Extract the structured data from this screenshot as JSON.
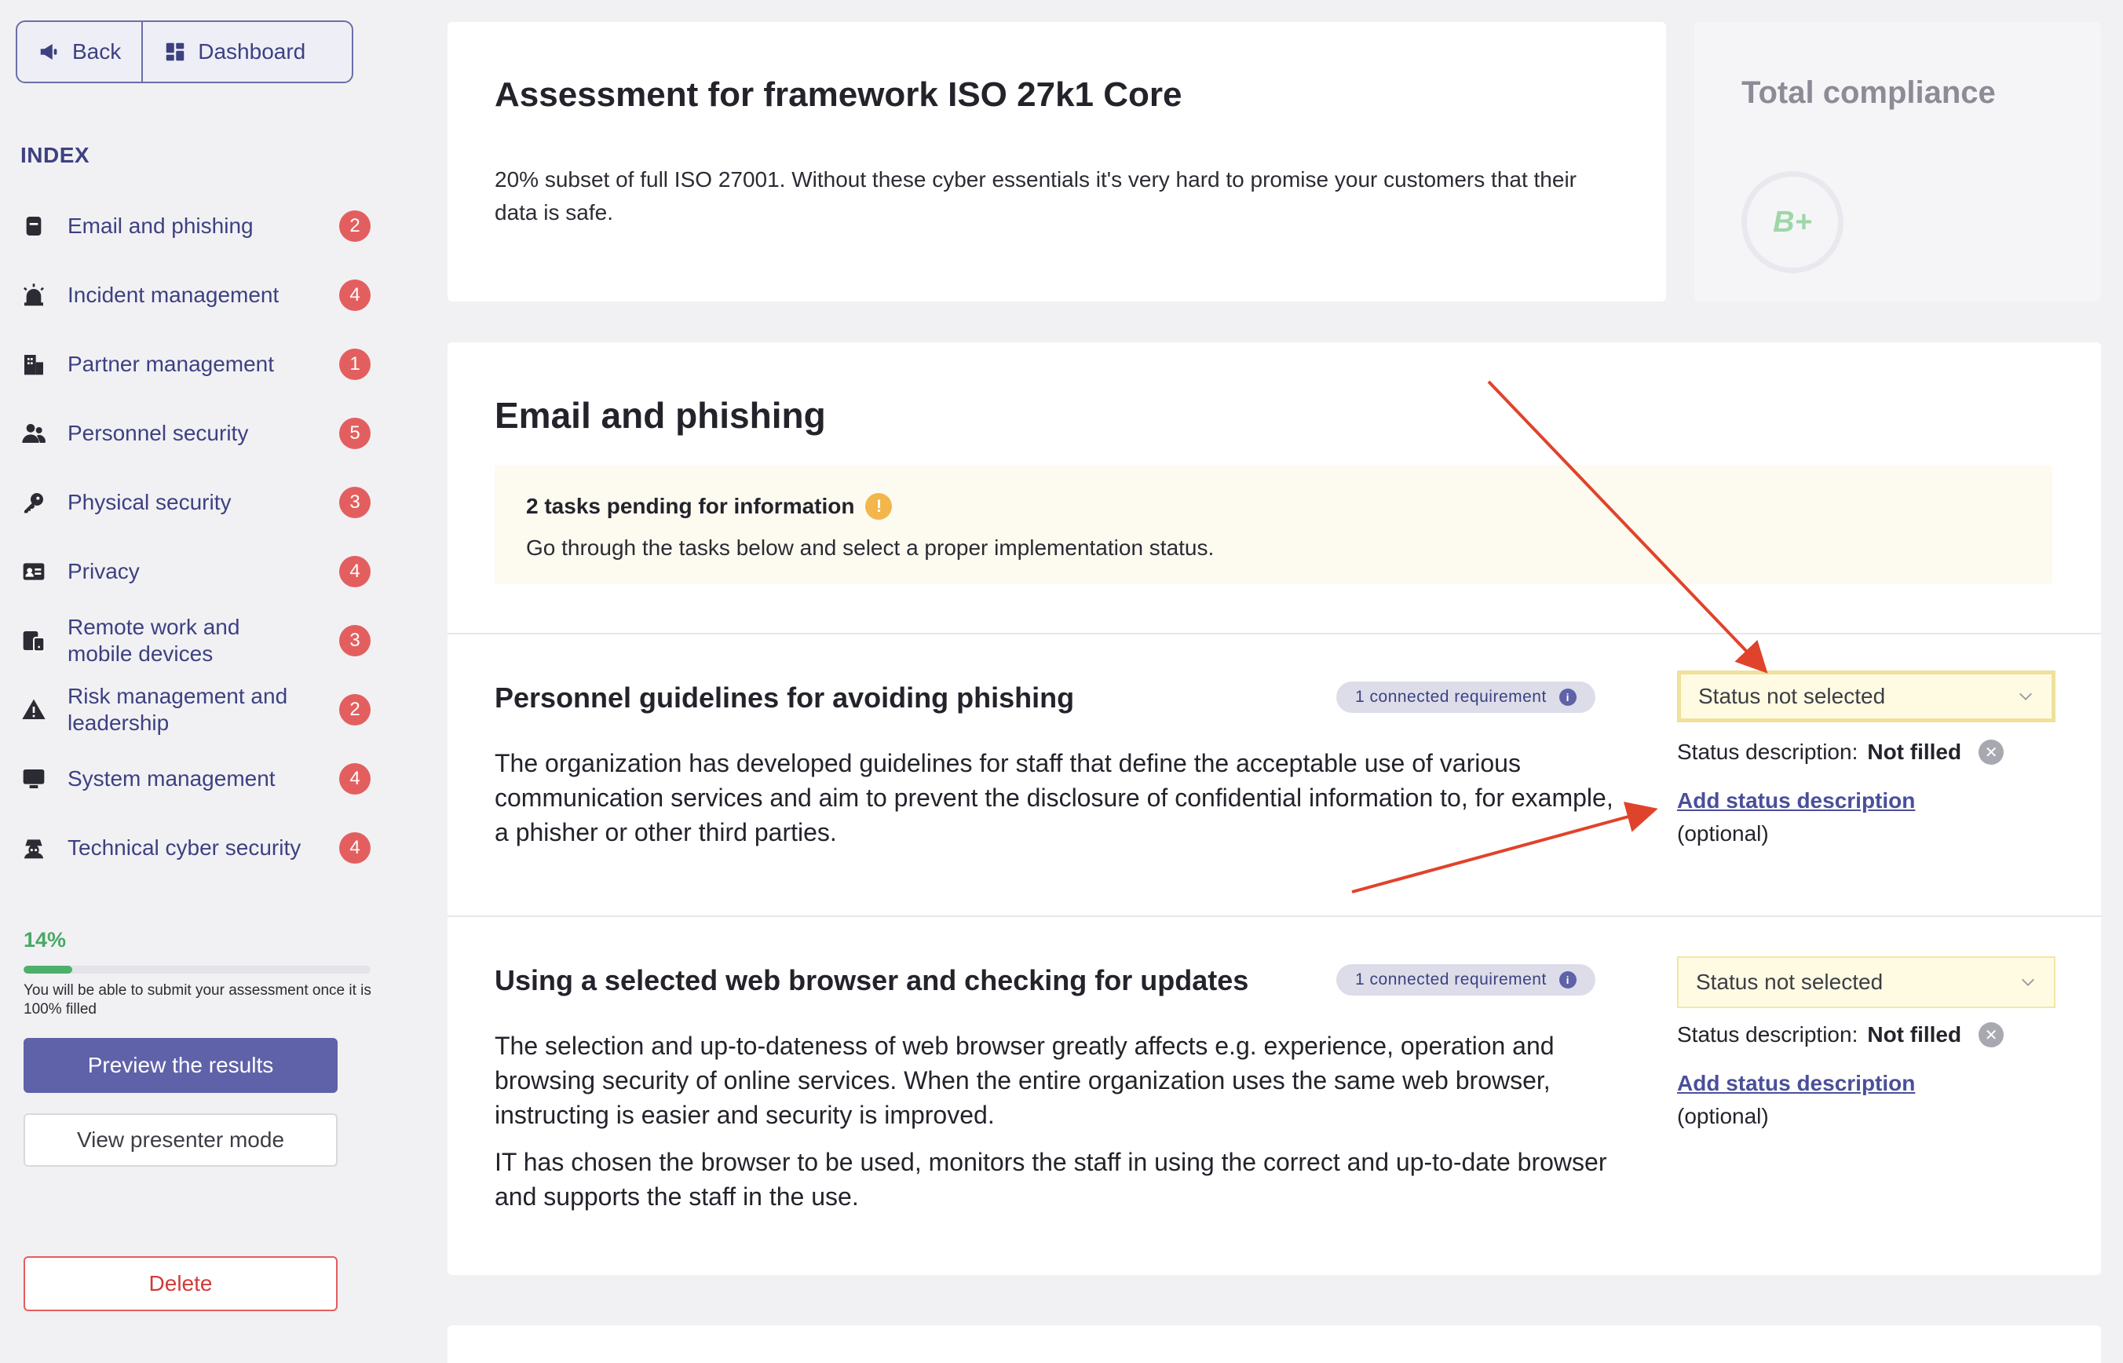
{
  "nav": {
    "back_label": "Back",
    "dashboard_label": "Dashboard"
  },
  "sidebar": {
    "index_title": "INDEX",
    "items": [
      {
        "label": "Email and phishing",
        "count": "2",
        "icon": "email-icon"
      },
      {
        "label": "Incident management",
        "count": "4",
        "icon": "alarm-icon"
      },
      {
        "label": "Partner management",
        "count": "1",
        "icon": "building-icon"
      },
      {
        "label": "Personnel security",
        "count": "5",
        "icon": "users-icon"
      },
      {
        "label": "Physical security",
        "count": "3",
        "icon": "key-icon"
      },
      {
        "label": "Privacy",
        "count": "4",
        "icon": "id-card-icon"
      },
      {
        "label": "Remote work and mobile devices",
        "count": "3",
        "icon": "devices-icon"
      },
      {
        "label": "Risk management and leadership",
        "count": "2",
        "icon": "warning-icon"
      },
      {
        "label": "System management",
        "count": "4",
        "icon": "monitor-icon"
      },
      {
        "label": "Technical cyber security",
        "count": "4",
        "icon": "user-secret-icon"
      }
    ],
    "progress_percent": 14,
    "progress_label": "14%",
    "progress_hint": "You will be able to submit your assessment once it is 100% filled",
    "preview_label": "Preview the results",
    "presenter_label": "View presenter mode",
    "delete_label": "Delete"
  },
  "hero": {
    "title": "Assessment for framework ISO 27k1 Core",
    "description": "20% subset of full ISO 27001. Without these cyber essentials it's very hard to promise your customers that their data is safe."
  },
  "compliance": {
    "title": "Total compliance",
    "grade": "B+"
  },
  "section": {
    "title": "Email and phishing",
    "notice_title": "2 tasks pending for information",
    "notice_icon": "!",
    "notice_text": "Go through the tasks below and select a proper implementation status.",
    "tasks": [
      {
        "title": "Personnel guidelines for avoiding phishing",
        "requirement": "1 connected requirement",
        "description": "The organization has developed guidelines for staff that define the acceptable use of various communication services and aim to prevent the disclosure of confidential information to, for example, a phisher or other third parties.",
        "status": "Status not selected",
        "status_desc_label": "Status description:",
        "status_desc_value": "Not filled",
        "add_label": "Add status description",
        "optional": "(optional)"
      },
      {
        "title": "Using a selected web browser and checking for updates",
        "requirement": "1 connected requirement",
        "description": "The selection and up-to-dateness of web browser greatly affects e.g. experience, operation and browsing security of online services. When the entire organization uses the same web browser, instructing is easier and security is improved.",
        "description2": "IT has chosen the browser to be used, monitors the staff in using the correct and up-to-date browser and supports the staff in the use.",
        "status": "Status not selected",
        "status_desc_label": "Status description:",
        "status_desc_value": "Not filled",
        "add_label": "Add status description",
        "optional": "(optional)"
      }
    ]
  },
  "colors": {
    "accent": "#5f62a8",
    "badge": "#e35f5f",
    "annotation_arrow": "#e0432b",
    "select_bg": "#fffbe3"
  }
}
